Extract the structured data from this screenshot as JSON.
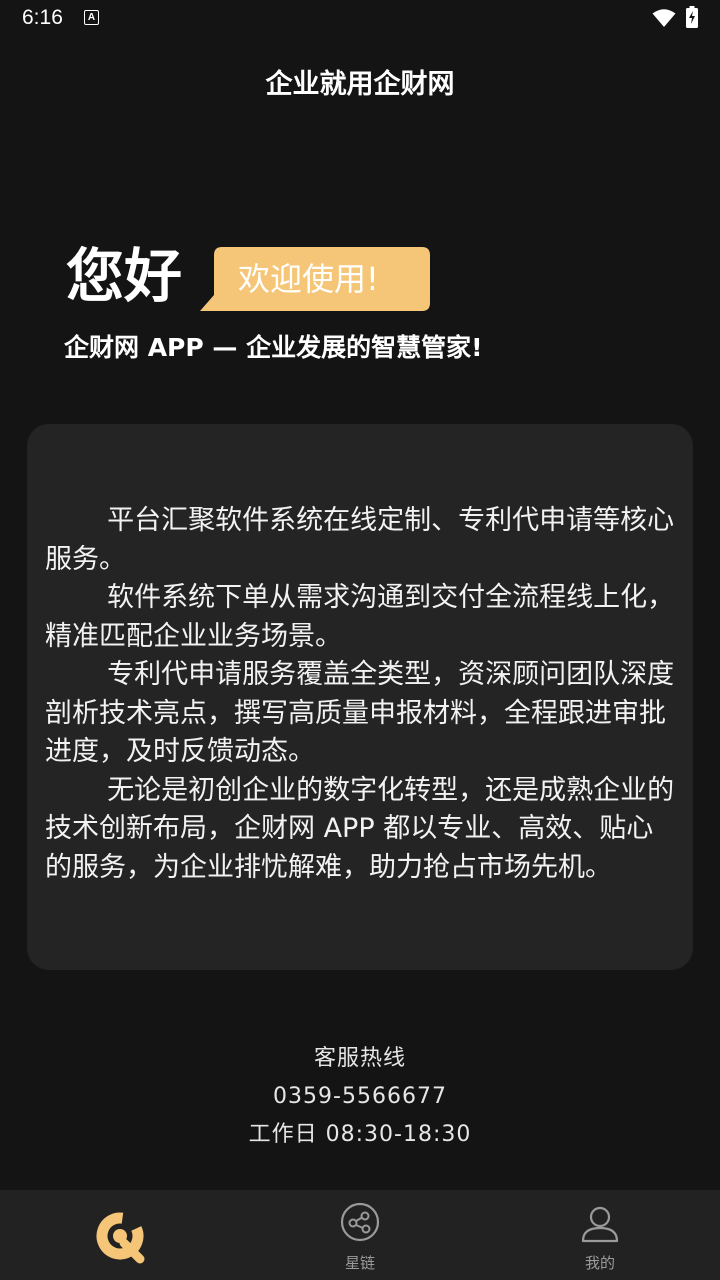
{
  "status_bar": {
    "time": "6:16",
    "notification_icon": "a-icon",
    "wifi_icon": "wifi-icon",
    "battery_icon": "battery-charging-icon"
  },
  "header": {
    "title": "企业就用企财网"
  },
  "hero": {
    "greeting": "您好",
    "welcome": "欢迎使用!",
    "tagline": "企财网 APP — 企业发展的智慧管家!"
  },
  "intro": {
    "paragraphs": [
      "平台汇聚软件系统在线定制、专利代申请等核心服务。",
      "软件系统下单从需求沟通到交付全流程线上化，精准匹配企业业务场景。",
      "专利代申请服务覆盖全类型，资深顾问团队深度剖析技术亮点，撰写高质量申报材料，全程跟进审批进度，及时反馈动态。",
      "无论是初创企业的数字化转型，还是成熟企业的技术创新布局，企财网 APP 都以专业、高效、贴心的服务，为企业排忧解难，助力抢占市场先机。"
    ]
  },
  "contact": {
    "label": "客服热线",
    "phone": "0359-5566677",
    "hours": "工作日 08:30-18:30"
  },
  "bottom_nav": {
    "items": [
      {
        "label": "",
        "icon": "home-logo-icon",
        "active": true
      },
      {
        "label": "星链",
        "icon": "share-nodes-icon",
        "active": false
      },
      {
        "label": "我的",
        "icon": "user-icon",
        "active": false
      }
    ]
  },
  "colors": {
    "background": "#141414",
    "card": "#242424",
    "accent": "#f5c677",
    "nav_background": "#222222"
  }
}
